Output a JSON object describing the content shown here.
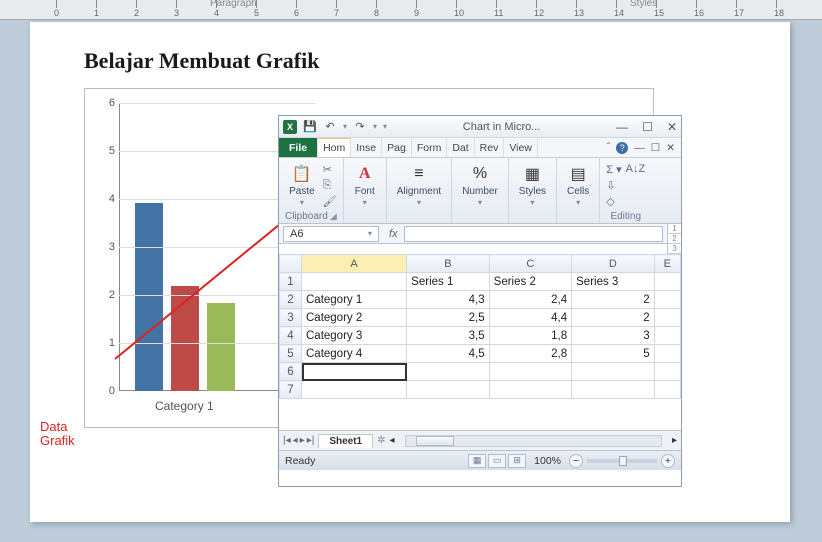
{
  "ruler": {
    "paragraph_label": "Paragraph",
    "styles_label": "Styles"
  },
  "doc": {
    "title": "Belajar Membuat Grafik",
    "annotation_l1": "Data",
    "annotation_l2": "Grafik"
  },
  "chart_data": {
    "type": "bar",
    "categories": [
      "Category 1",
      "Category 2",
      "Category 3",
      "Category 4"
    ],
    "series": [
      {
        "name": "Series 1",
        "color": "#4473a6",
        "values": [
          4.3,
          2.5,
          3.5,
          4.5
        ]
      },
      {
        "name": "Series 2",
        "color": "#bd4b48",
        "values": [
          2.4,
          4.4,
          1.8,
          2.8
        ]
      },
      {
        "name": "Series 3",
        "color": "#9aba59",
        "values": [
          2,
          2,
          3,
          5
        ]
      }
    ],
    "ylim": [
      0,
      6
    ],
    "yticks": [
      0,
      1,
      2,
      3,
      4,
      5,
      6
    ],
    "visible_category_label": "Category 1"
  },
  "excel": {
    "window_title": "Chart in Micro...",
    "qat": {
      "app": "X",
      "save": "💾",
      "undo": "↶",
      "redo": "↷"
    },
    "win": {
      "min": "—",
      "max": "☐",
      "close": "✕"
    },
    "tabs": {
      "file": "File",
      "home": "Hom",
      "insert": "Inse",
      "page": "Pag",
      "formulas": "Form",
      "data": "Dat",
      "review": "Rev",
      "view": "View",
      "help": "?",
      "mdi_min": "—",
      "mdi_max": "☐",
      "mdi_close": "✕"
    },
    "ribbon": {
      "clipboard": {
        "label": "Clipboard",
        "paste": "Paste",
        "paste_icon": "📋",
        "cut": "✂",
        "copy": "⎘",
        "fmt": "🖌"
      },
      "font": {
        "label": "Font",
        "icon": "A"
      },
      "alignment": {
        "label": "Alignment",
        "icon": "≡"
      },
      "number": {
        "label": "Number",
        "icon": "%"
      },
      "styles": {
        "label": "Styles",
        "icon": "▦"
      },
      "cells": {
        "label": "Cells",
        "icon": "▤"
      },
      "editing": {
        "label": "Editing",
        "sigma": "Σ",
        "sort": "A↓Z",
        "fill": "⇩",
        "clear": "◇"
      }
    },
    "formula_bar": {
      "name_box": "A6",
      "fx": "fx",
      "value": ""
    },
    "columns": [
      "A",
      "B",
      "C",
      "D",
      "E"
    ],
    "header_row": [
      "",
      "Series 1",
      "Series 2",
      "Series 3",
      ""
    ],
    "rows": [
      {
        "n": 2,
        "cat": "Category 1",
        "s1": "4,3",
        "s2": "2,4",
        "s3": "2"
      },
      {
        "n": 3,
        "cat": "Category 2",
        "s1": "2,5",
        "s2": "4,4",
        "s3": "2"
      },
      {
        "n": 4,
        "cat": "Category 3",
        "s1": "3,5",
        "s2": "1,8",
        "s3": "3"
      },
      {
        "n": 5,
        "cat": "Category 4",
        "s1": "4,5",
        "s2": "2,8",
        "s3": "5"
      }
    ],
    "active_row": 6,
    "sheet_tab": "Sheet1",
    "status": {
      "ready": "Ready",
      "zoom": "100%"
    }
  }
}
